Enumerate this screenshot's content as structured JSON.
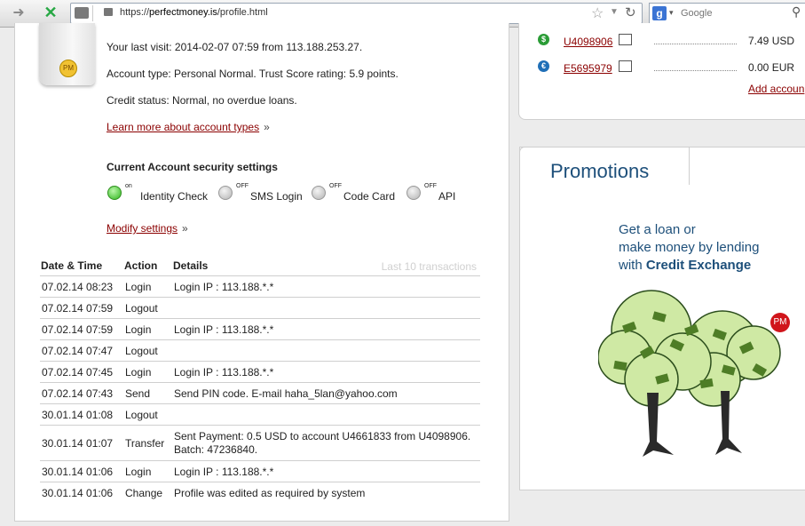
{
  "browser": {
    "url_prefix": "https://",
    "url_domain": "perfectmoney.is",
    "url_path": "/profile.html",
    "search_placeholder": "Google"
  },
  "profile": {
    "last_visit": "Your last visit: 2014-02-07 07:59 from 113.188.253.27.",
    "account_type": "Account type: Personal Normal. Trust Score rating: 5.9 points.",
    "credit_status": "Credit status: Normal, no overdue loans.",
    "learn_more": "Learn more about account types",
    "raquo": "»"
  },
  "security": {
    "title": "Current Account security settings",
    "items": [
      {
        "state": "on",
        "label": "Identity Check"
      },
      {
        "state": "OFF",
        "label": "SMS Login"
      },
      {
        "state": "OFF",
        "label": "Code Card"
      },
      {
        "state": "OFF",
        "label": "API"
      }
    ],
    "modify": "Modify settings"
  },
  "transactions": {
    "headers": [
      "Date & Time",
      "Action",
      "Details"
    ],
    "note": "Last 10 transactions",
    "rows": [
      {
        "date": "07.02.14 08:23",
        "action": "Login",
        "details": "Login IP : 113.188.*.*",
        "details2": ""
      },
      {
        "date": "07.02.14 07:59",
        "action": "Logout",
        "details": "",
        "details2": ""
      },
      {
        "date": "07.02.14 07:59",
        "action": "Login",
        "details": "Login IP : 113.188.*.*",
        "details2": ""
      },
      {
        "date": "07.02.14 07:47",
        "action": "Logout",
        "details": "",
        "details2": ""
      },
      {
        "date": "07.02.14 07:45",
        "action": "Login",
        "details": "Login IP : 113.188.*.*",
        "details2": ""
      },
      {
        "date": "07.02.14 07:43",
        "action": "Send",
        "details": "Send PIN code. E-mail haha_5lan@yahoo.com",
        "details2": ""
      },
      {
        "date": "30.01.14 01:08",
        "action": "Logout",
        "details": "",
        "details2": ""
      },
      {
        "date": "30.01.14 01:07",
        "action": "Transfer",
        "details": "Sent Payment: 0.5 USD to account U4661833 from U4098906.",
        "details2": "Batch: 47236840."
      },
      {
        "date": "30.01.14 01:06",
        "action": "Login",
        "details": "Login IP : 113.188.*.*",
        "details2": ""
      },
      {
        "date": "30.01.14 01:06",
        "action": "Change",
        "details": "Profile was edited as required by system",
        "details2": ""
      }
    ]
  },
  "accounts": {
    "items": [
      {
        "symbol": "$",
        "id": "U4098906",
        "amount": "7.49 USD",
        "color": "#2a9c36"
      },
      {
        "symbol": "€",
        "id": "E5695979",
        "amount": "0.00 EUR",
        "color": "#1f6fb7"
      }
    ],
    "add_link": "Add accoun"
  },
  "promotions": {
    "title": "Promotions",
    "line1": "Get a loan or",
    "line2": "make money by lending",
    "line3_prefix": "with ",
    "line3_bold": "Credit Exchange",
    "logo": "PM"
  },
  "colors": {
    "link": "#8b0000",
    "promo_text": "#1d4f7a",
    "on_indicator": "#2fb51d"
  }
}
